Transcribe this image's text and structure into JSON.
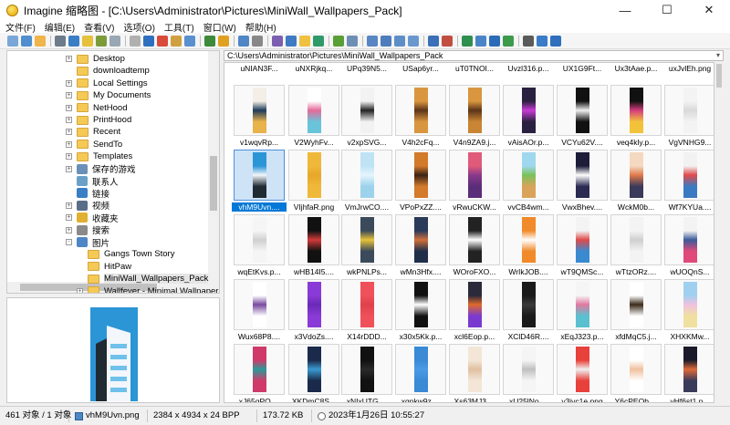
{
  "window": {
    "title": "Imagine 缩略图 - [C:\\Users\\Administrator\\Pictures\\MiniWall_Wallpapers_Pack]",
    "minimize": "—",
    "maximize": "☐",
    "close": "✕"
  },
  "menu": [
    "文件(F)",
    "编辑(E)",
    "查看(V)",
    "选项(O)",
    "工具(T)",
    "窗口(W)",
    "帮助(H)"
  ],
  "toolbar_colors": [
    "#7aa7d8",
    "#4f8fd0",
    "#f0b44a",
    "#6d7b8a",
    "#3a7ec5",
    "#e6c13a",
    "#7c9c3a",
    "#9aa7b4",
    "#b0b0b0",
    "#2f6fc0",
    "#d84a3a",
    "#d0a040",
    "#5a8fd0",
    "#3d8a3a",
    "#e0a020",
    "#4f86c6",
    "#888888",
    "#7c5fb0",
    "#3f7ac2",
    "#f0c040",
    "#2e9a6a",
    "#5a9e36",
    "#6e8fb5",
    "#5886c4",
    "#4d7dbd",
    "#5e8ec7",
    "#6998cf",
    "#3b6fb7",
    "#c14f41",
    "#2f8f4f",
    "#4a84c8",
    "#2b6cb8",
    "#3c9a4a",
    "#5a5a5a",
    "#3a7cc7",
    "#2f6fbd"
  ],
  "tree": {
    "items": [
      {
        "label": "Desktop",
        "icon": "folder",
        "expander": "+"
      },
      {
        "label": "downloadtemp",
        "icon": "folder",
        "expander": ""
      },
      {
        "label": "Local Settings",
        "icon": "folder",
        "expander": "+"
      },
      {
        "label": "My Documents",
        "icon": "folder",
        "expander": "+"
      },
      {
        "label": "NetHood",
        "icon": "folder",
        "expander": "+"
      },
      {
        "label": "PrintHood",
        "icon": "folder",
        "expander": "+"
      },
      {
        "label": "Recent",
        "icon": "folder",
        "expander": "+"
      },
      {
        "label": "SendTo",
        "icon": "folder",
        "expander": "+"
      },
      {
        "label": "Templates",
        "icon": "folder",
        "expander": "+"
      },
      {
        "label": "保存的游戏",
        "icon": "saved-games-icon",
        "expander": "+"
      },
      {
        "label": "联系人",
        "icon": "contacts-icon",
        "expander": ""
      },
      {
        "label": "链接",
        "icon": "links-icon",
        "expander": ""
      },
      {
        "label": "视频",
        "icon": "videos-icon",
        "expander": "+"
      },
      {
        "label": "收藏夹",
        "icon": "favorites-icon",
        "expander": "+"
      },
      {
        "label": "搜索",
        "icon": "search-icon",
        "expander": "+"
      },
      {
        "label": "图片",
        "icon": "pictures-icon",
        "expander": "-"
      },
      {
        "label": "Gangs Town Story",
        "icon": "folder",
        "expander": ""
      },
      {
        "label": "HitPaw",
        "icon": "folder",
        "expander": ""
      },
      {
        "label": "MiniWall_Wallpapers_Pack",
        "icon": "folder",
        "expander": "",
        "selected": true
      },
      {
        "label": "Wallfever - Minimal Wallpaper",
        "icon": "folder",
        "expander": "+"
      }
    ]
  },
  "path": "C:\\Users\\Administrator\\Pictures\\MiniWall_Wallpapers_Pack",
  "path_arrow": "▾",
  "grid": {
    "top_labels": [
      "uNIAN3F...",
      "uNXRjkq...",
      "UPq39N5...",
      "USap6yr...",
      "uT0TNOI...",
      "Uvzl316.p...",
      "UX1G9Ft...",
      "Ux3tAae.p...",
      "uxJvlEh.png"
    ],
    "rows": [
      [
        {
          "label": "v1wqvRp...",
          "colors": [
            "#f3efe6",
            "#1f3a5a",
            "#e8b34a"
          ]
        },
        {
          "label": "V2WyhFv...",
          "colors": [
            "#ffffff",
            "#e46b9a",
            "#69c3d9"
          ]
        },
        {
          "label": "v2xpSVG...",
          "colors": [
            "#f2f2f2",
            "#222222",
            "#f2f2f2"
          ]
        },
        {
          "label": "V4h2cFq...",
          "colors": [
            "#d9963f",
            "#5b3418",
            "#d9963f"
          ]
        },
        {
          "label": "V4n9ZA9.j...",
          "colors": [
            "#d9963f",
            "#5b3418",
            "#c98533"
          ]
        },
        {
          "label": "vAisAOr.p...",
          "colors": [
            "#2a2140",
            "#c83bd6",
            "#2a2140"
          ]
        },
        {
          "label": "VCYu62V....",
          "colors": [
            "#111111",
            "#f0f0f0",
            "#111111"
          ]
        },
        {
          "label": "veq4kly.p...",
          "colors": [
            "#111111",
            "#d43c7c",
            "#f2c33a"
          ]
        },
        {
          "label": "VgVNHG9...",
          "colors": [
            "#f3f3f3",
            "#d9d9d9",
            "#f3f3f3"
          ]
        }
      ],
      [
        {
          "label": "vhM9Uvn....",
          "colors": [
            "#2b95d6",
            "#f3f6fa",
            "#1f2a33"
          ],
          "selected": true
        },
        {
          "label": "VIjhfaR.png",
          "colors": [
            "#f0b83a",
            "#e7a72a",
            "#f0b83a"
          ]
        },
        {
          "label": "VmJrwCO....",
          "colors": [
            "#bfe3f5",
            "#e6f5fc",
            "#9dd2ec"
          ]
        },
        {
          "label": "VPoPxZZ....",
          "colors": [
            "#d37a2b",
            "#3b2316",
            "#d37a2b"
          ]
        },
        {
          "label": "vRwuCKW...",
          "colors": [
            "#e05a7a",
            "#8a3a8a",
            "#5a2d7a"
          ]
        },
        {
          "label": "vvCB4wm...",
          "colors": [
            "#9fd8ee",
            "#7ac25a",
            "#d9a35a"
          ]
        },
        {
          "label": "VwxBhev....",
          "colors": [
            "#1d1d3a",
            "#ffffff",
            "#2a2a52"
          ]
        },
        {
          "label": "WckM0b...",
          "colors": [
            "#f4d9c0",
            "#e07a4a",
            "#3a3a5a"
          ]
        },
        {
          "label": "Wf7KYUa....",
          "colors": [
            "#f2f2f2",
            "#e04a4a",
            "#3a7ac2"
          ]
        }
      ],
      [
        {
          "label": "wqEtKvs.p...",
          "colors": [
            "#f5f5f5",
            "#d0d0d0",
            "#f5f5f5"
          ]
        },
        {
          "label": "wHB14I5....",
          "colors": [
            "#111111",
            "#d13a3a",
            "#111111"
          ]
        },
        {
          "label": "wkPNLPs...",
          "colors": [
            "#3a4a5a",
            "#e8c23a",
            "#3a4a5a"
          ]
        },
        {
          "label": "wMn3Hfx....",
          "colors": [
            "#2a3a5a",
            "#d0703a",
            "#1f2f4a"
          ]
        },
        {
          "label": "WOroFXO...",
          "colors": [
            "#222222",
            "#ffffff",
            "#222222"
          ]
        },
        {
          "label": "WrIkJOB....",
          "colors": [
            "#f08a2a",
            "#ffffff",
            "#f08a2a"
          ]
        },
        {
          "label": "wT9QMSc...",
          "colors": [
            "#f3f3f3",
            "#e04a4a",
            "#3a8ad0"
          ]
        },
        {
          "label": "wTtzORz....",
          "colors": [
            "#f3f3f3",
            "#cfcfcf",
            "#f3f3f3"
          ]
        },
        {
          "label": "wUOQnS...",
          "colors": [
            "#f3f3f3",
            "#3a5a9a",
            "#e04a7a"
          ]
        }
      ],
      [
        {
          "label": "Wux68P8....",
          "colors": [
            "#ffffff",
            "#7a4aa0",
            "#ffffff"
          ]
        },
        {
          "label": "x3VdoZs....",
          "colors": [
            "#8a3ad6",
            "#6a2ab6",
            "#8a3ad6"
          ]
        },
        {
          "label": "X14rDDD...",
          "colors": [
            "#f0505a",
            "#e0404a",
            "#f0505a"
          ]
        },
        {
          "label": "x30x5Kk.p...",
          "colors": [
            "#111111",
            "#ffffff",
            "#111111"
          ]
        },
        {
          "label": "xcl6Eop.p...",
          "colors": [
            "#2a2a3a",
            "#e06a2a",
            "#7a3ad0"
          ]
        },
        {
          "label": "XClD46R....",
          "colors": [
            "#1a1a1a",
            "#3a3a3a",
            "#1a1a1a"
          ]
        },
        {
          "label": "xEqJ323.p...",
          "colors": [
            "#f5f5f5",
            "#e07aa0",
            "#5ac0d0"
          ]
        },
        {
          "label": "xfdMqC5.j...",
          "colors": [
            "#ffffff",
            "#3a2a1a",
            "#ffffff"
          ]
        },
        {
          "label": "XHXKMw...",
          "colors": [
            "#a0d0f0",
            "#f0c0e0",
            "#f0e0a0"
          ]
        }
      ],
      [
        {
          "label": "xJ65qPO....",
          "colors": [
            "#d03a6a",
            "#2a9a9a",
            "#d03a6a"
          ]
        },
        {
          "label": "XKDmC8S...",
          "colors": [
            "#1a2a4a",
            "#3a9ad0",
            "#1a2a4a"
          ]
        },
        {
          "label": "xNIxUTG....",
          "colors": [
            "#111111",
            "#2a2a2a",
            "#111111"
          ]
        },
        {
          "label": "xqpkw9z....",
          "colors": [
            "#3a8ad6",
            "#4a9ae6",
            "#3a8ad6"
          ]
        },
        {
          "label": "Xs63MJ3....",
          "colors": [
            "#f3e6d6",
            "#e0c0a0",
            "#f3e6d6"
          ]
        },
        {
          "label": "xU25lNo....",
          "colors": [
            "#f5f5f5",
            "#c0c0c0",
            "#f5f5f5"
          ]
        },
        {
          "label": "y3jyc1e.png",
          "colors": [
            "#e8403a",
            "#f0f0f0",
            "#e8403a"
          ]
        },
        {
          "label": "Y6cPEOb....",
          "colors": [
            "#ffffff",
            "#f0c0a0",
            "#ffffff"
          ]
        },
        {
          "label": "yHf6st1.p...",
          "colors": [
            "#1a1a2a",
            "#e06a3a",
            "#3a3a5a"
          ]
        }
      ]
    ]
  },
  "status": {
    "count": "461 对象 / 1 对象",
    "filename": "vhM9Uvn.png",
    "dimensions": "2384 x 4934 x 24 BPP",
    "size": "173.72 KB",
    "date": "2023年1月26日 10:55:27"
  }
}
